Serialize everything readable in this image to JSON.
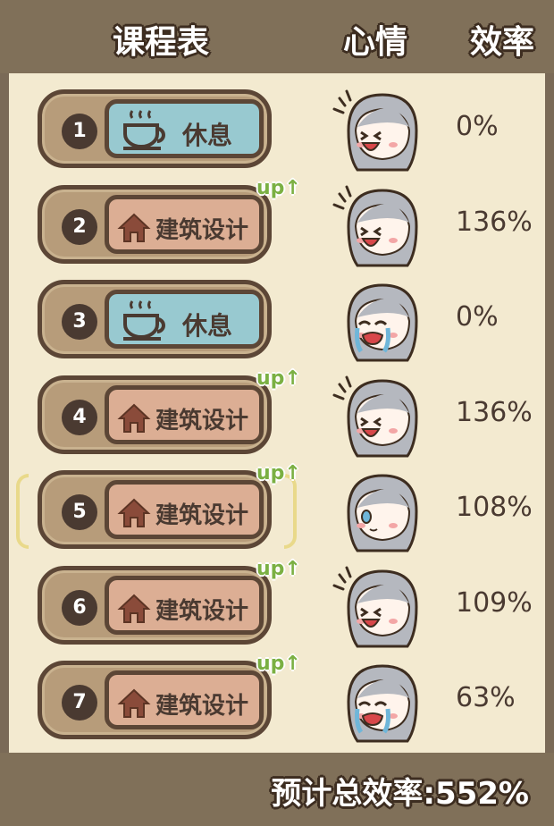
{
  "header": {
    "schedule": "课程表",
    "mood": "心情",
    "efficiency": "效率"
  },
  "rows": [
    {
      "num": "1",
      "activity": "休息",
      "type": "rest",
      "up": "",
      "mood": "happy",
      "efficiency": "0%"
    },
    {
      "num": "2",
      "activity": "建筑设计",
      "type": "study",
      "up": "up",
      "mood": "happy",
      "efficiency": "136%"
    },
    {
      "num": "3",
      "activity": "休息",
      "type": "rest",
      "up": "",
      "mood": "crying",
      "efficiency": "0%"
    },
    {
      "num": "4",
      "activity": "建筑设计",
      "type": "study",
      "up": "up",
      "mood": "happy",
      "efficiency": "136%"
    },
    {
      "num": "5",
      "activity": "建筑设计",
      "type": "study",
      "up": "up",
      "mood": "calm",
      "efficiency": "108%"
    },
    {
      "num": "6",
      "activity": "建筑设计",
      "type": "study",
      "up": "up",
      "mood": "happy",
      "efficiency": "109%"
    },
    {
      "num": "7",
      "activity": "建筑设计",
      "type": "study",
      "up": "up",
      "mood": "crying",
      "efficiency": "63%"
    }
  ],
  "selected_row": "5",
  "footer": {
    "total": "预计总效率:552%"
  },
  "colors": {
    "frame": "#807059",
    "slot": "#b79c7a",
    "rest_card": "#98c9d0",
    "study_card": "#dcae94",
    "up_badge": "#7bb043"
  }
}
